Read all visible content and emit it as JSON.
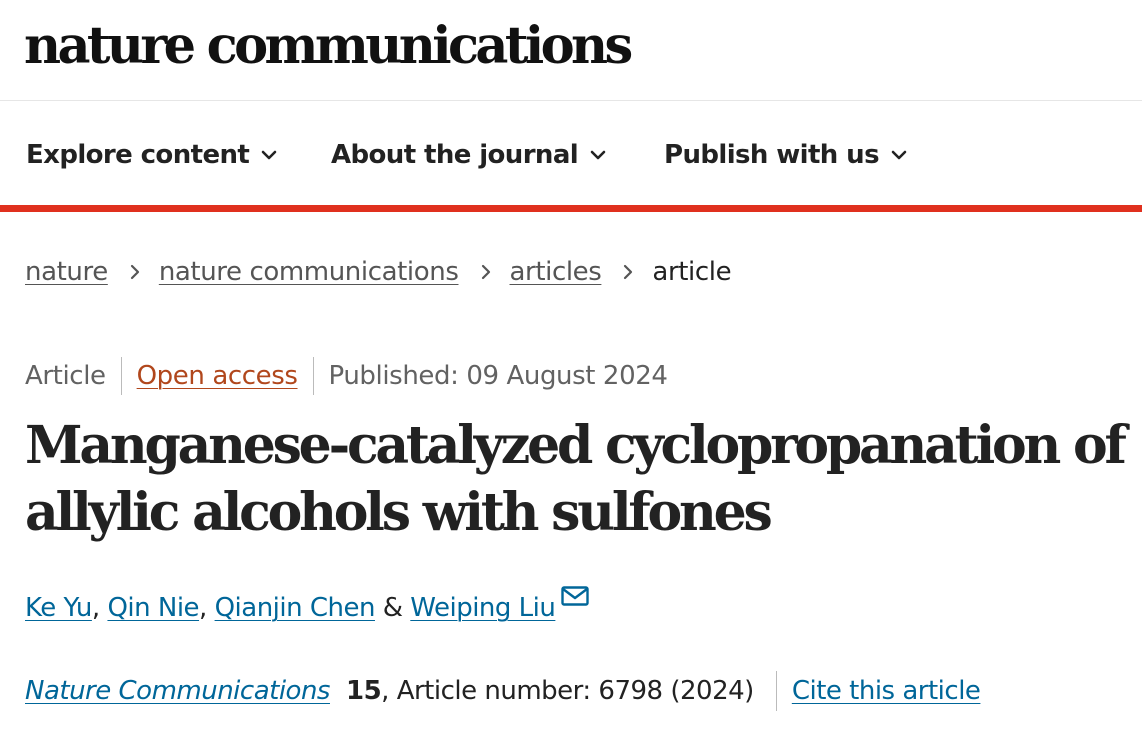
{
  "header": {
    "brand": "nature communications"
  },
  "nav": {
    "items": [
      {
        "label": "Explore content"
      },
      {
        "label": "About the journal"
      },
      {
        "label": "Publish with us"
      }
    ]
  },
  "breadcrumb": {
    "items": [
      "nature",
      "nature communications",
      "articles"
    ],
    "current": "article"
  },
  "article": {
    "type": "Article",
    "access": "Open access",
    "published": "Published: 09 August 2024",
    "title": "Manganese-catalyzed cyclopropanation of allylic alcohols with sulfones",
    "authors": [
      "Ke Yu",
      "Qin Nie",
      "Qianjin Chen",
      "Weiping Liu"
    ],
    "author_separators": [
      ", ",
      ", ",
      " & "
    ],
    "corresponding_icon": "mail-icon",
    "journal": "Nature Communications",
    "volume": "15",
    "article_number": ", Article number: 6798 (2024)",
    "cite_label": "Cite this article"
  },
  "colors": {
    "accent_red": "#e0301e",
    "link_blue": "#006699",
    "open_access_orange": "#b1471c"
  }
}
